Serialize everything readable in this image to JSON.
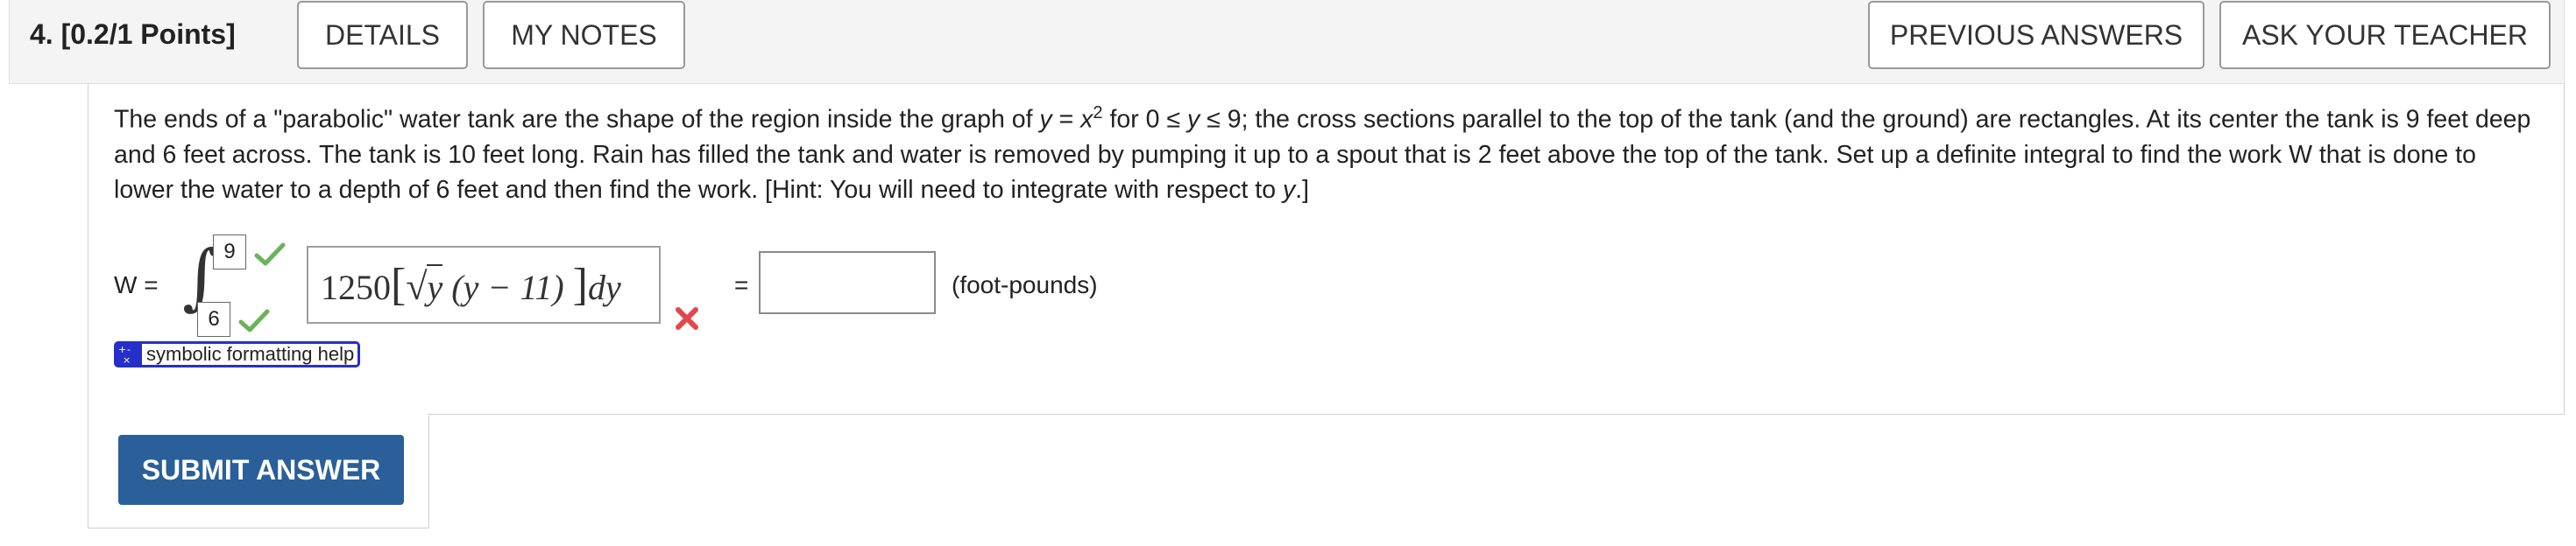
{
  "header": {
    "question_number": "4.",
    "points": "[0.2/1 Points]",
    "details_label": "DETAILS",
    "my_notes_label": "MY NOTES",
    "previous_answers_label": "PREVIOUS ANSWERS",
    "ask_teacher_label": "ASK YOUR TEACHER"
  },
  "question": {
    "p1": "The ends of a \"parabolic\" water tank are the shape of the region inside the graph of ",
    "y_var": "y",
    "eq_part": " = ",
    "x_var": "x",
    "exp": "2",
    "p2": " for ",
    "range_a": "0 ≤ ",
    "range_y": "y",
    "range_b": " ≤ 9",
    "p3": "; the cross sections parallel to the top of the tank (and the ground) are rectangles. At its center the tank is 9 feet deep and 6 feet across. The tank is 10 feet long. Rain has filled the tank and water is removed by pumping it up to a spout that is 2 feet above the top of the tank. Set up a definite integral to find the work W that is done to lower the water to a depth of 6 feet and then find the work. [Hint: You will need to integrate with respect to ",
    "hint_var": "y",
    "p4": ".]"
  },
  "answer": {
    "w_label": "W =",
    "upper_limit": "9",
    "lower_limit": "6",
    "expr_coef": "1250",
    "expr_open": "[",
    "expr_sqrt": "√",
    "expr_y": "y",
    "expr_factor": " (y − 11) ",
    "expr_close": "]",
    "expr_dy": "dy",
    "equals": "=",
    "work_value": "",
    "units": "(foot-pounds)",
    "symbolic_help": "symbolic formatting help",
    "submit_label": "SUBMIT ANSWER"
  },
  "colors": {
    "correct": "#6bb35a",
    "incorrect": "#e0484d",
    "submit": "#2a5f99",
    "help_badge": "#2630c8"
  }
}
